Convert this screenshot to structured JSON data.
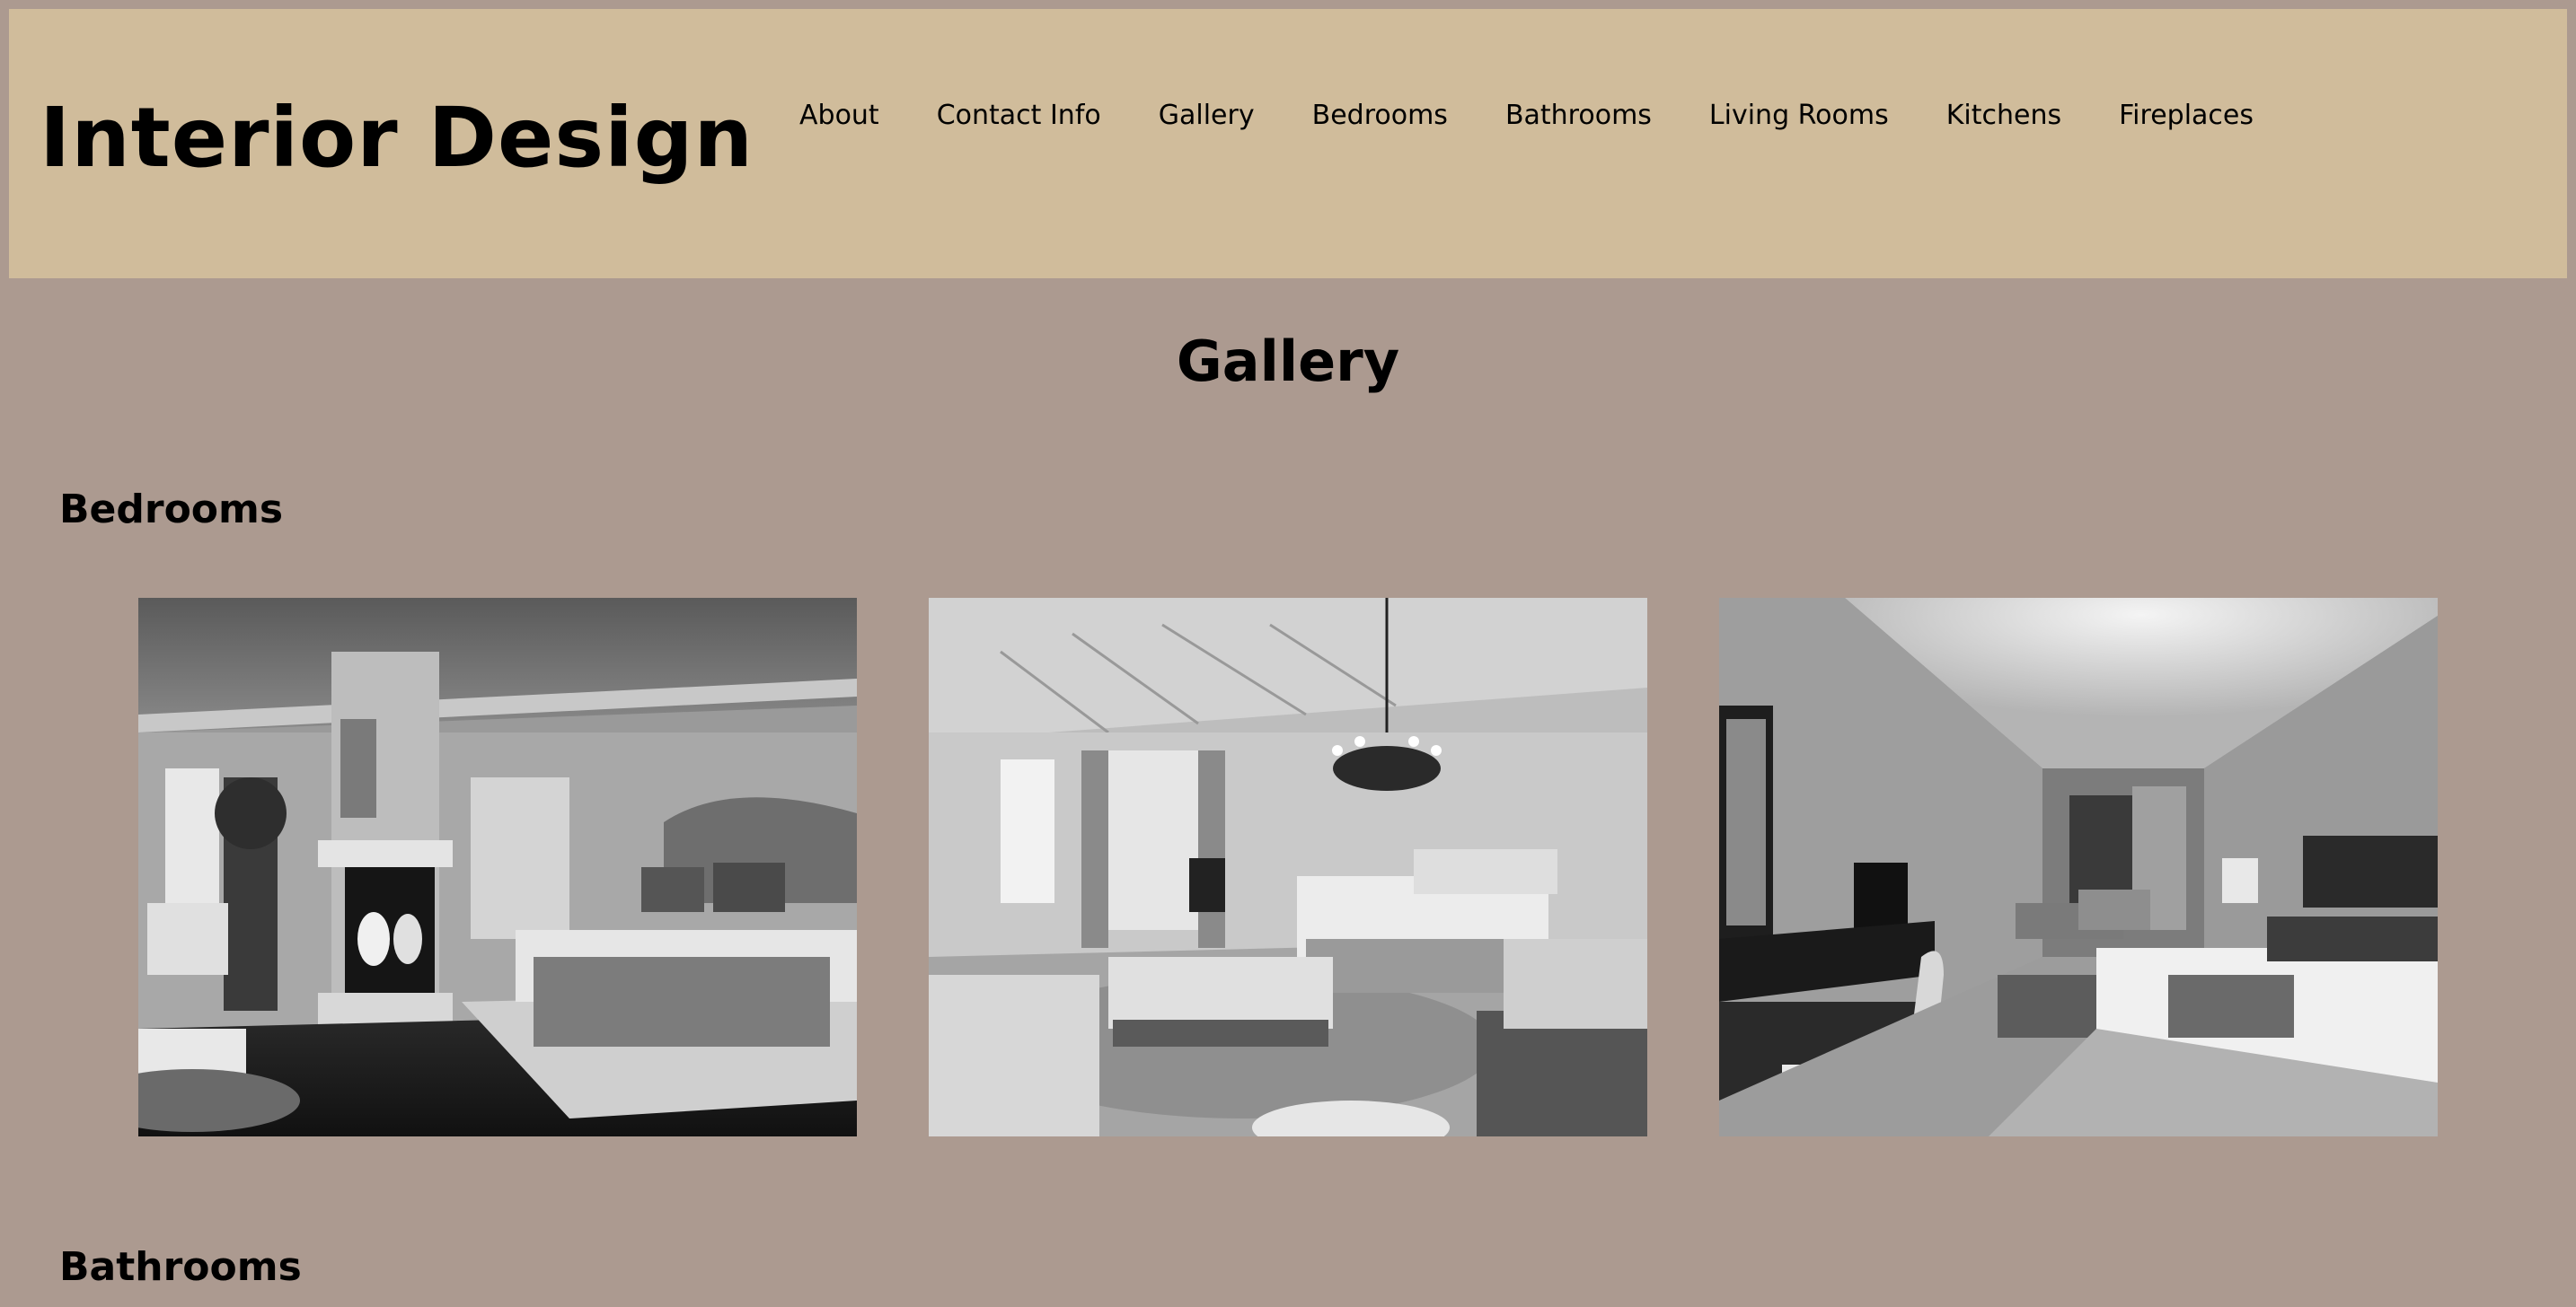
{
  "header": {
    "site_title": "Interior Design",
    "nav": [
      "About",
      "Contact Info",
      "Gallery",
      "Bedrooms",
      "Bathrooms",
      "Living Rooms",
      "Kitchens",
      "Fireplaces"
    ]
  },
  "main": {
    "page_heading": "Gallery",
    "sections": [
      {
        "heading": "Bedrooms",
        "photo_count": 3
      },
      {
        "heading": "Bathrooms"
      }
    ]
  },
  "colors": {
    "page_background": "#ac9a90",
    "header_background": "#d0bc9b",
    "text": "#000000"
  }
}
